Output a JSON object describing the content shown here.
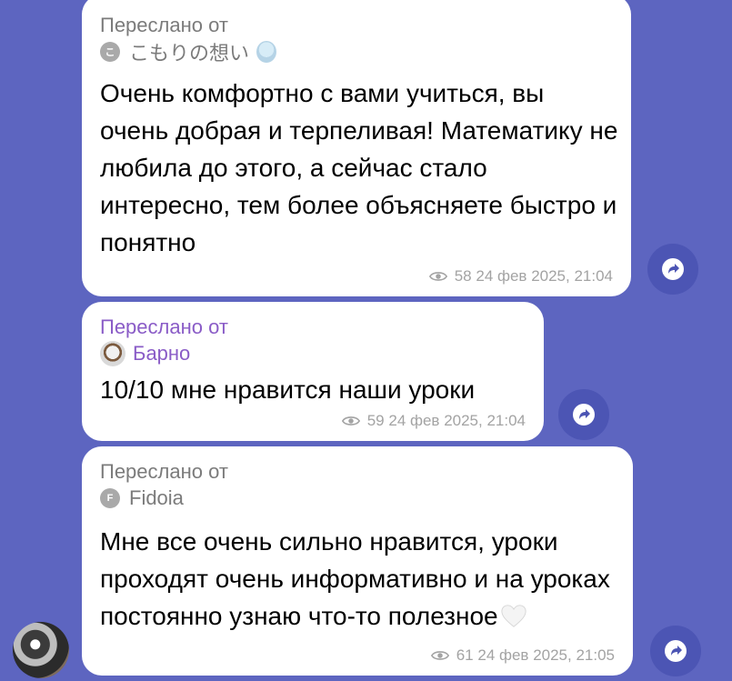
{
  "colors": {
    "background": "#5d65c0",
    "bubble": "#ffffff",
    "share_button": "#4c55b4",
    "forward_label_purple": "#8a5cc7",
    "meta_gray": "#a3a3a3"
  },
  "messages": [
    {
      "forwarded_label": "Переслано от",
      "sender_initial": "こ",
      "sender_name": "こもりの想い",
      "text": "Очень комфортно с вами учиться, вы очень добрая и терпеливая! Математику не любила до этого, а сейчас стало интересно, тем более объясняете быстро и понятно",
      "views": "58",
      "time": "24 фев 2025, 21:04"
    },
    {
      "forwarded_label": "Переслано от",
      "sender_name": "Барно",
      "text": "10/10 мне нравится наши уроки",
      "views": "59",
      "time": "24 фев 2025, 21:04"
    },
    {
      "forwarded_label": "Переслано от",
      "sender_initial": "F",
      "sender_name": "Fidoia",
      "text": "Мне все очень сильно нравится, уроки проходят очень информативно и на уроках постоянно узнаю что-то полезное",
      "views": "61",
      "time": "24 фев 2025, 21:05"
    }
  ],
  "icons": {
    "share": "share-arrow-icon",
    "views": "eye-icon",
    "heart": "white-heart-emoji"
  }
}
